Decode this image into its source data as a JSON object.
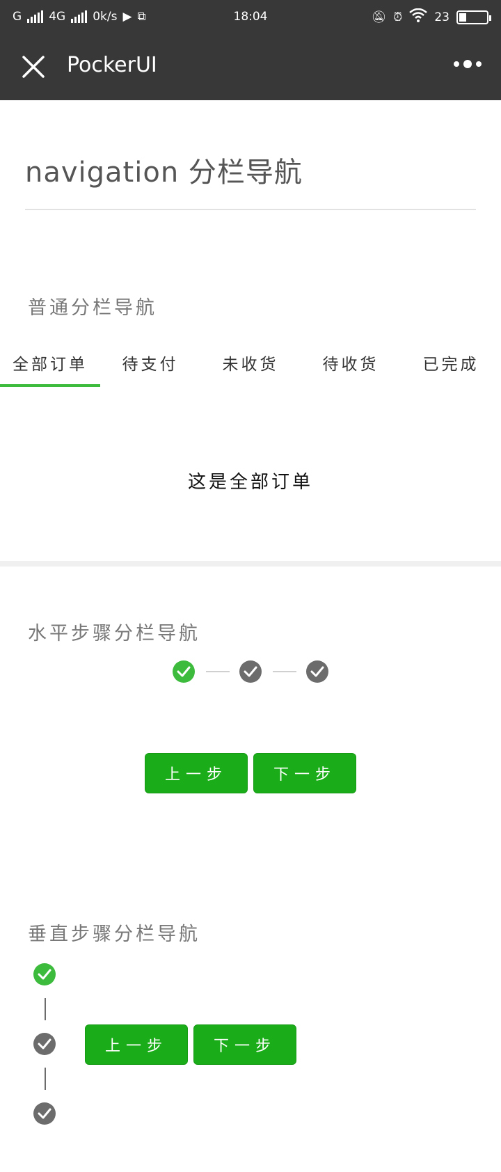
{
  "statusbar": {
    "carrier": "G",
    "network": "4G",
    "speed": "0k/s",
    "time": "18:04",
    "battery": "23"
  },
  "header": {
    "title": "PockerUI"
  },
  "page": {
    "title": "navigation 分栏导航"
  },
  "normal_nav": {
    "label": "普通分栏导航",
    "tabs": [
      {
        "label": "全部订单"
      },
      {
        "label": "待支付"
      },
      {
        "label": "未收货"
      },
      {
        "label": "待收货"
      },
      {
        "label": "已完成"
      }
    ],
    "active_tab": 0,
    "content": "这是全部订单"
  },
  "horizontal_steps": {
    "label": "水平步骤分栏导航",
    "steps": [
      {
        "state": "done"
      },
      {
        "state": "todo"
      },
      {
        "state": "todo"
      }
    ],
    "prev_label": "上一步",
    "next_label": "下一步"
  },
  "vertical_steps": {
    "label": "垂直步骤分栏导航",
    "steps": [
      {
        "state": "done"
      },
      {
        "state": "todo"
      },
      {
        "state": "todo"
      }
    ],
    "prev_label": "上一步",
    "next_label": "下一步"
  },
  "colors": {
    "accent": "#3dbb3d",
    "button": "#1aad19",
    "header": "#383838",
    "inactive_step": "#6c6c6c"
  }
}
